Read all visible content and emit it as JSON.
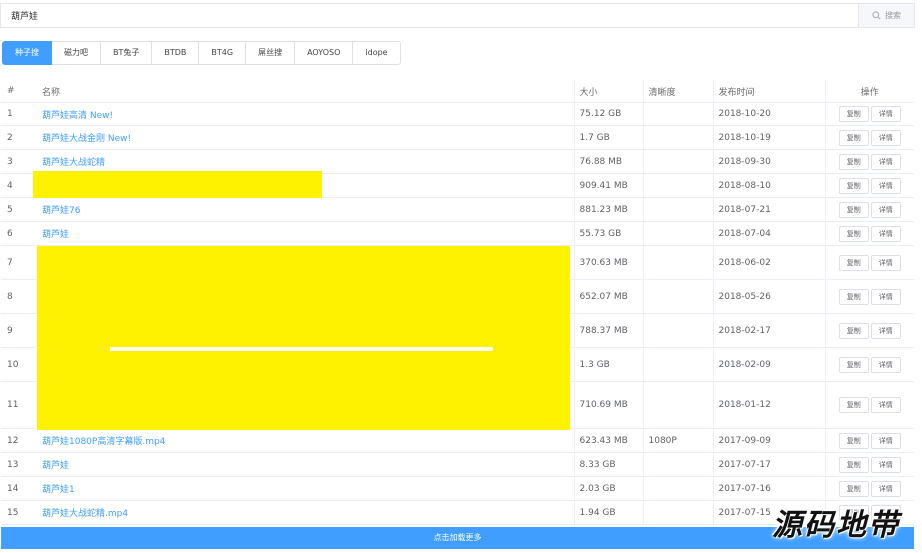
{
  "search": {
    "value": "葫芦娃",
    "button_label": "搜索",
    "icon": "search-icon"
  },
  "tabs": [
    "种子搜",
    "磁力吧",
    "BT兔子",
    "BTDB",
    "BT4G",
    "屌丝搜",
    "AOYOSO",
    "idope"
  ],
  "active_tab": 0,
  "columns": {
    "num": "#",
    "name": "名称",
    "size": "大小",
    "resolution": "清晰度",
    "date": "发布时间",
    "ops": "操作"
  },
  "ops": {
    "copy": "复制",
    "detail": "详情"
  },
  "rows": [
    {
      "num": "1",
      "name": "葫芦娃高清 New!",
      "size": "75.12 GB",
      "res": "",
      "date": "2018-10-20"
    },
    {
      "num": "2",
      "name": "葫芦娃大战金刚 New!",
      "size": "1.7 GB",
      "res": "",
      "date": "2018-10-19"
    },
    {
      "num": "3",
      "name": "葫芦娃大战蛇精",
      "size": "76.88 MB",
      "res": "",
      "date": "2018-09-30"
    },
    {
      "num": "4",
      "name": "",
      "size": "909.41 MB",
      "res": "",
      "date": "2018-08-10"
    },
    {
      "num": "5",
      "name": "葫芦娃76",
      "size": "881.23 MB",
      "res": "",
      "date": "2018-07-21"
    },
    {
      "num": "6",
      "name": "葫芦娃",
      "size": "55.73 GB",
      "res": "",
      "date": "2018-07-04"
    },
    {
      "num": "7",
      "name": "",
      "size": "370.63 MB",
      "res": "",
      "date": "2018-06-02"
    },
    {
      "num": "8",
      "name": "",
      "size": "652.07 MB",
      "res": "",
      "date": "2018-05-26"
    },
    {
      "num": "9",
      "name": "",
      "size": "788.37 MB",
      "res": "",
      "date": "2018-02-17"
    },
    {
      "num": "10",
      "name": "",
      "size": "1.3 GB",
      "res": "",
      "date": "2018-02-09"
    },
    {
      "num": "11",
      "name": "",
      "size": "710.69 MB",
      "res": "",
      "date": "2018-01-12"
    },
    {
      "num": "12",
      "name": "葫芦娃1080P高清字幕版.mp4",
      "size": "623.43 MB",
      "res": "1080P",
      "date": "2017-09-09"
    },
    {
      "num": "13",
      "name": "葫芦娃",
      "size": "8.33 GB",
      "res": "",
      "date": "2017-07-17"
    },
    {
      "num": "14",
      "name": "葫芦娃1",
      "size": "2.03 GB",
      "res": "",
      "date": "2017-07-16"
    },
    {
      "num": "15",
      "name": "葫芦娃大战蛇精.mp4",
      "size": "1.94 GB",
      "res": "",
      "date": "2017-07-15"
    }
  ],
  "load_more": "点击加载更多",
  "watermark": "源码地带",
  "colors": {
    "accent": "#409eff",
    "redaction": "#fff200"
  }
}
